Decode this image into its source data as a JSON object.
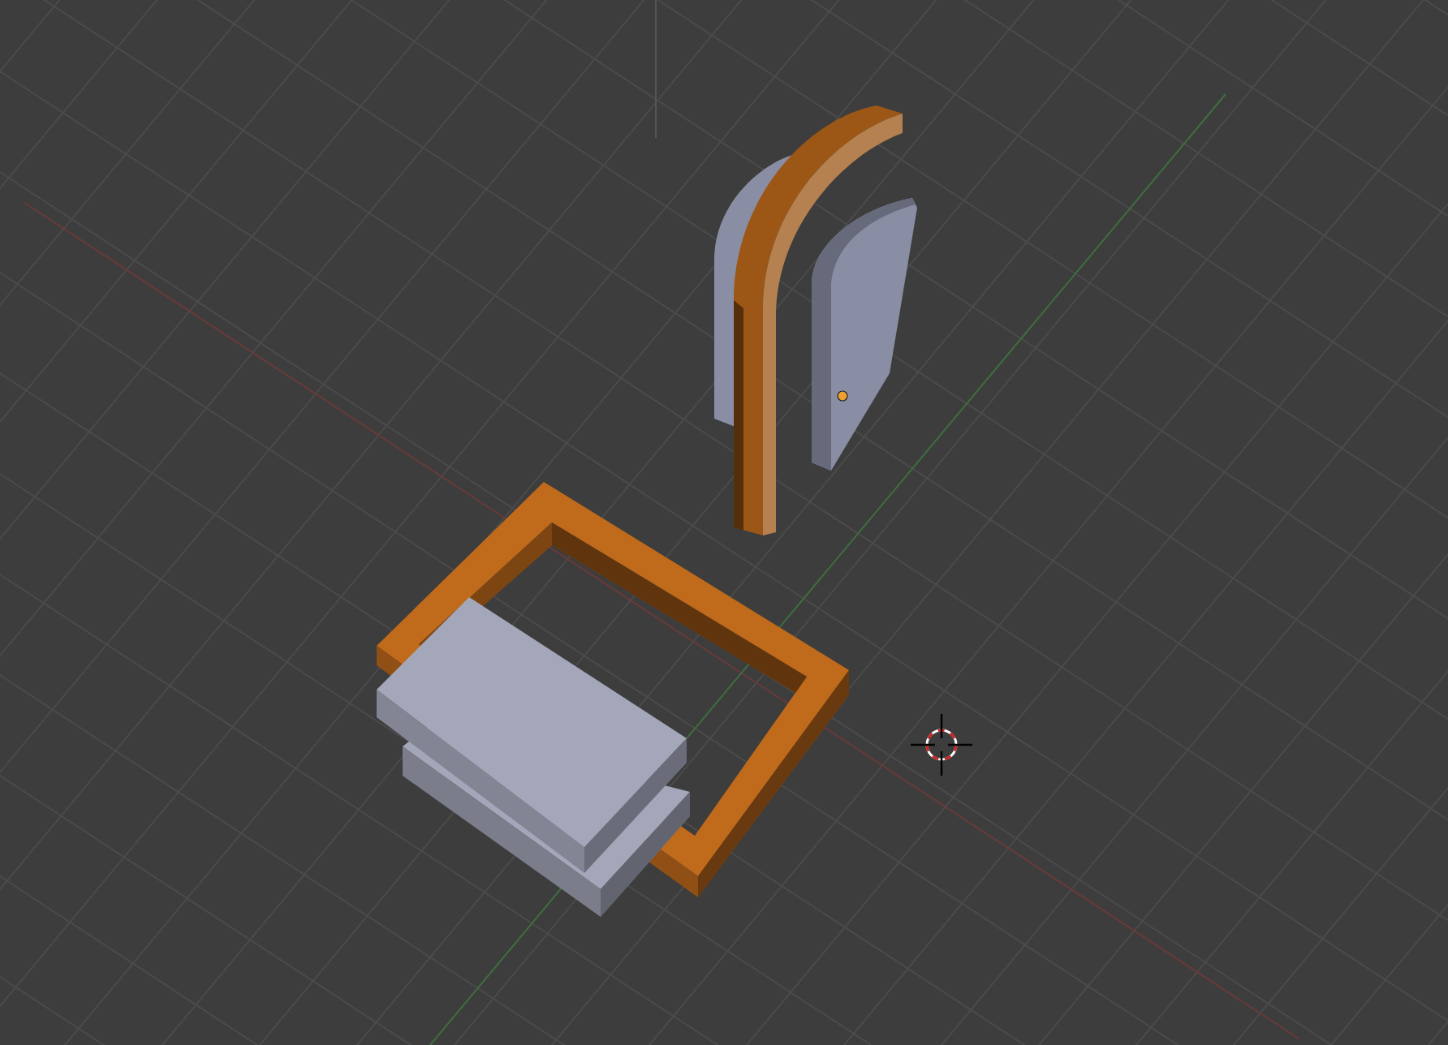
{
  "scene": {
    "objects": [
      {
        "kind": "frame",
        "color": "#c06a1c"
      },
      {
        "kind": "block-lower",
        "color": "#a4a7ba"
      },
      {
        "kind": "block",
        "color": "#a4a7ba"
      },
      {
        "kind": "door-panel-left",
        "color": "#8a8ea4"
      },
      {
        "kind": "door-frame",
        "color": "#9c5716"
      },
      {
        "kind": "door-panel-right",
        "color": "#8a8ea4"
      }
    ]
  }
}
